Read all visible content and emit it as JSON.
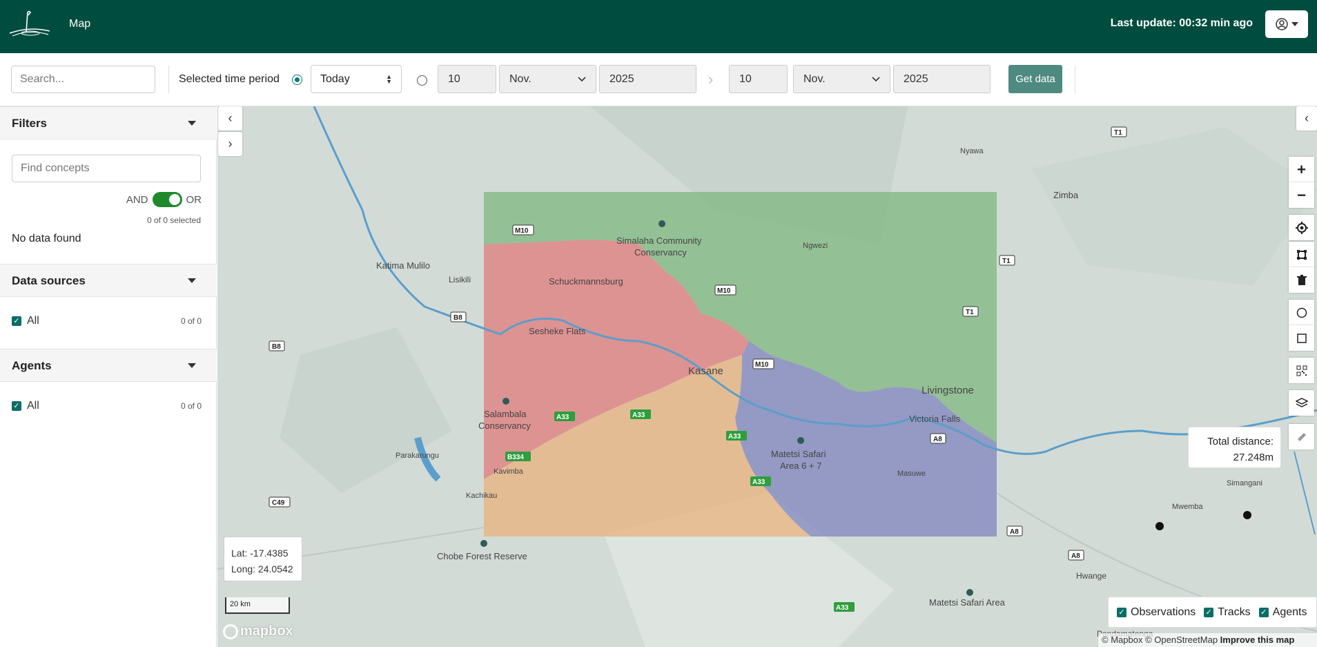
{
  "header": {
    "nav_map": "Map",
    "last_update": "Last update: 00:32 min ago"
  },
  "toolbar": {
    "search_placeholder": "Search...",
    "period_label": "Selected time period",
    "period_select": "Today",
    "from_day": "10",
    "from_month": "Nov.",
    "from_year": "2025",
    "to_day": "10",
    "to_month": "Nov.",
    "to_year": "2025",
    "get_data": "Get data",
    "today_radio_selected": true
  },
  "sidebar": {
    "filters": {
      "title": "Filters",
      "find_placeholder": "Find concepts",
      "and_label": "AND",
      "or_label": "OR",
      "selected_count": "0 of 0 selected",
      "no_data": "No data found"
    },
    "data_sources": {
      "title": "Data sources",
      "items": [
        {
          "label": "All",
          "count": "0 of 0",
          "checked": true
        }
      ]
    },
    "agents": {
      "title": "Agents",
      "items": [
        {
          "label": "All",
          "count": "0 of 0",
          "checked": true
        }
      ]
    }
  },
  "map": {
    "coords": {
      "lat": "Lat: -17.4385",
      "long": "Long: 24.0542"
    },
    "scale": "20 km",
    "mapbox_logo": "mapbox",
    "distance": {
      "label": "Total distance:",
      "value": "27.248m"
    },
    "layers": [
      {
        "label": "Observations",
        "checked": true
      },
      {
        "label": "Tracks",
        "checked": true
      },
      {
        "label": "Agents",
        "checked": true
      }
    ],
    "attribution": {
      "mapbox": "© Mapbox",
      "osm": "© OpenStreetMap",
      "improve": "Improve this map"
    },
    "place_labels": {
      "nyawa": "Nyawa",
      "zimba": "Zimba",
      "katima": "Katima Mulilo",
      "lisikili": "Lisikili",
      "simalaha_1": "Simalaha Community",
      "simalaha_2": "Conservancy",
      "ngwezi": "Ngwezi",
      "schuckmannsburg": "Schuckmannsburg",
      "sesheke": "Sesheke Flats",
      "kasane": "Kasane",
      "livingstone": "Livingstone",
      "victoria_falls": "Victoria Falls",
      "salambala_1": "Salambala",
      "salambala_2": "Conservancy",
      "matetsi_1": "Matetsi Safari",
      "matetsi_2": "Area 6 + 7",
      "parakarungu": "Parakarungu",
      "kavimba": "Kavimba",
      "kachikau": "Kachikau",
      "masuwe": "Masuwe",
      "simangani": "Simangani",
      "mwemba": "Mwemba",
      "chobe": "Chobe Forest Reserve",
      "hwange": "Hwange",
      "matetsi_area": "Matetsi Safari Area",
      "pandamatenga": "Pandamatenga"
    },
    "road_labels": {
      "t1_a": "T1",
      "t1_b": "T1",
      "t1_c": "T1",
      "m10_a": "M10",
      "m10_b": "M10",
      "m10_c": "M10",
      "b8_a": "B8",
      "b8_b": "B8",
      "c49": "C49",
      "a8_a": "A8",
      "a8_b": "A8",
      "a8_c": "A8",
      "a33_a": "A33",
      "a33_b": "A33",
      "a33_c": "A33",
      "a33_d": "A33",
      "a33_e": "A33",
      "b334": "B334"
    },
    "region_colors": {
      "green": "#7fb77f",
      "red": "#e07b7b",
      "orange": "#e8b27d",
      "purple": "#7f84bd"
    }
  }
}
